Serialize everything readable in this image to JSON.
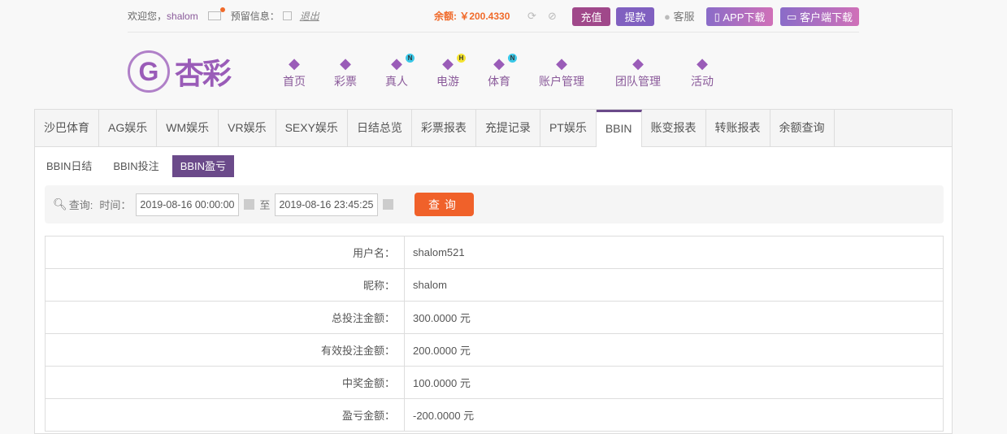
{
  "top": {
    "welcome": "欢迎您，",
    "username": "shalom",
    "reserved": "预留信息：",
    "logout": "退出",
    "balance": "余额: ￥200.4330",
    "recharge": "充值",
    "withdraw": "提款",
    "service": "客服",
    "app": "APP下载",
    "client": "客户端下载"
  },
  "logo": {
    "text": "杏彩"
  },
  "nav": [
    {
      "label": "首页",
      "icon": "home-icon"
    },
    {
      "label": "彩票",
      "icon": "ticket-icon"
    },
    {
      "label": "真人",
      "icon": "live-dealer-icon",
      "badge": "N"
    },
    {
      "label": "电游",
      "icon": "gamepad-icon",
      "badge": "H"
    },
    {
      "label": "体育",
      "icon": "trophy-icon",
      "badge": "N"
    },
    {
      "label": "账户管理",
      "icon": "yen-coin-icon"
    },
    {
      "label": "团队管理",
      "icon": "team-icon"
    },
    {
      "label": "活动",
      "icon": "gift-icon"
    }
  ],
  "tabs": [
    "沙巴体育",
    "AG娱乐",
    "WM娱乐",
    "VR娱乐",
    "SEXY娱乐",
    "日结总览",
    "彩票报表",
    "充提记录",
    "PT娱乐",
    "BBIN",
    "账变报表",
    "转账报表",
    "余额查询"
  ],
  "subtabs": [
    "BBIN日结",
    "BBIN投注",
    "BBIN盈亏"
  ],
  "query": {
    "label": "查询:",
    "time": "时间：",
    "start": "2019-08-16 00:00:00",
    "to": "至",
    "end": "2019-08-16 23:45:25",
    "button": "查询"
  },
  "rows": [
    {
      "k": "用户名：",
      "v": "shalom521"
    },
    {
      "k": "昵称：",
      "v": "shalom"
    },
    {
      "k": "总投注金额：",
      "v": "300.0000 元"
    },
    {
      "k": "有效投注金额：",
      "v": "200.0000 元"
    },
    {
      "k": "中奖金额：",
      "v": "100.0000 元"
    },
    {
      "k": "盈亏金额：",
      "v": "-200.0000 元"
    }
  ],
  "colors": {
    "accent": "#6b4a8a",
    "orange": "#f0612a"
  }
}
